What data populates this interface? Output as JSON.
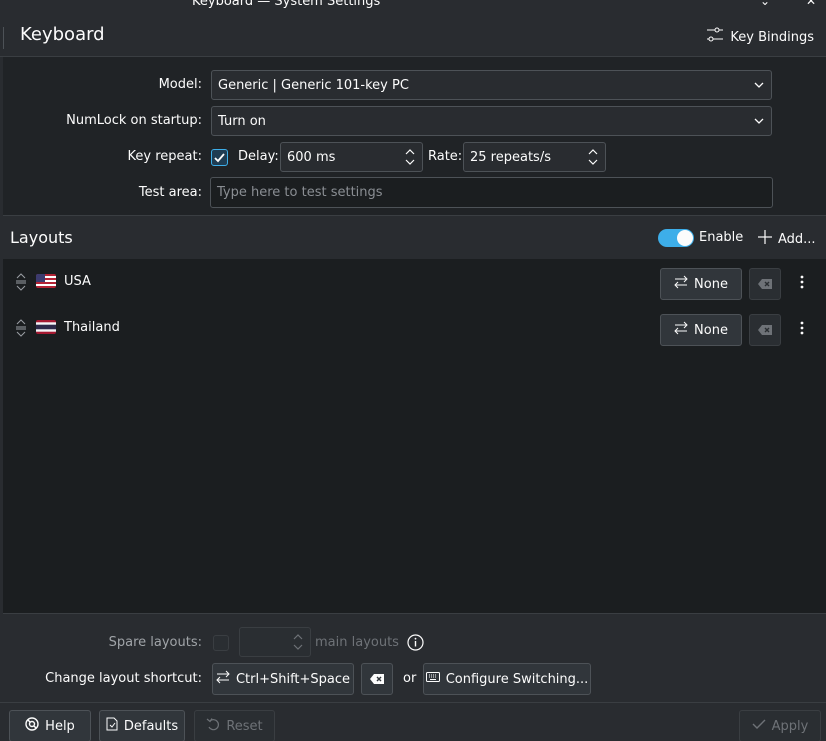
{
  "window": {
    "title": "Keyboard — System Settings"
  },
  "header": {
    "page_title": "Keyboard",
    "key_bindings_label": "Key Bindings"
  },
  "form": {
    "model_label": "Model:",
    "model_value": "Generic | Generic 101-key PC",
    "numlock_label": "NumLock on startup:",
    "numlock_value": "Turn on",
    "key_repeat_label": "Key repeat:",
    "key_repeat_checked": true,
    "delay_label": "Delay:",
    "delay_value": "600 ms",
    "rate_label": "Rate:",
    "rate_value": "25 repeats/s",
    "test_area_label": "Test area:",
    "test_area_placeholder": "Type here to test settings"
  },
  "layouts": {
    "title": "Layouts",
    "enable_label": "Enable",
    "enabled": true,
    "add_label": "Add...",
    "items": [
      {
        "name": "USA",
        "flag": "us-flag",
        "shortcut_label": "None"
      },
      {
        "name": "Thailand",
        "flag": "thailand-flag",
        "shortcut_label": "None"
      }
    ]
  },
  "spare": {
    "label": "Spare layouts:",
    "suffix": "main layouts",
    "checked": false,
    "value": ""
  },
  "shortcut": {
    "label": "Change layout shortcut:",
    "value": "Ctrl+Shift+Space",
    "or_label": "or",
    "configure_label": "Configure Switching..."
  },
  "footer": {
    "help_label": "Help",
    "defaults_label": "Defaults",
    "reset_label": "Reset",
    "apply_label": "Apply"
  },
  "colors": {
    "accent": "#3daee9",
    "background": "#202326",
    "panel": "#292c30",
    "list_background": "#1b1e20"
  }
}
